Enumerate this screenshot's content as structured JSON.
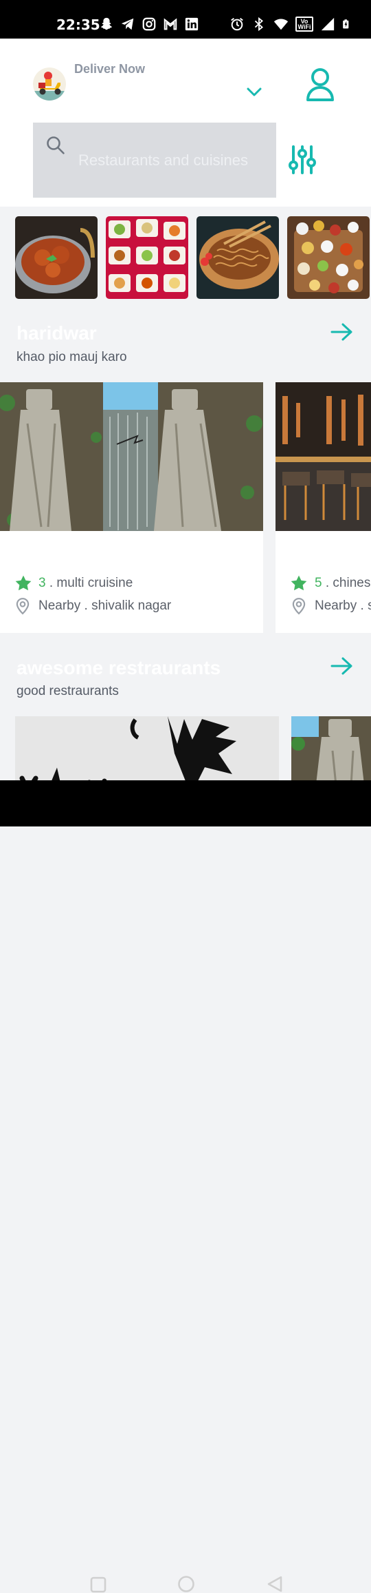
{
  "status_bar": {
    "time": "22:35",
    "left_icons": [
      "snapchat-icon",
      "telegram-icon",
      "instagram-icon",
      "gmail-icon",
      "linkedin-icon"
    ],
    "right_icons": [
      "alarm-icon",
      "bluetooth-icon",
      "wifi-icon",
      "vowifi-icon",
      "signal-icon",
      "battery-icon"
    ],
    "vowifi_text": "Vo WiFi"
  },
  "header": {
    "deliver_label": "Deliver Now",
    "search_placeholder": "Restaurants and cuisines"
  },
  "cuisines": [
    {
      "name": "curry",
      "icon": "curry-bowl-image"
    },
    {
      "name": "thali",
      "icon": "thali-tray-image"
    },
    {
      "name": "noodles",
      "icon": "noodles-plate-image"
    },
    {
      "name": "platter",
      "icon": "platter-image"
    }
  ],
  "sections": [
    {
      "title": "haridwar",
      "subtitle": "khao pio mauj karo",
      "cards": [
        {
          "rating": "3",
          "cuisine": " . multi cruisine",
          "location": "Nearby . shivalik nagar"
        },
        {
          "rating": "5",
          "cuisine": " . chinese",
          "location": "Nearby . s"
        }
      ]
    },
    {
      "title": "awesome restraurants",
      "subtitle": "good restraurants"
    }
  ],
  "colors": {
    "accent": "#17b9b0",
    "rating_green": "#41b45f",
    "background": "#f2f3f5"
  }
}
